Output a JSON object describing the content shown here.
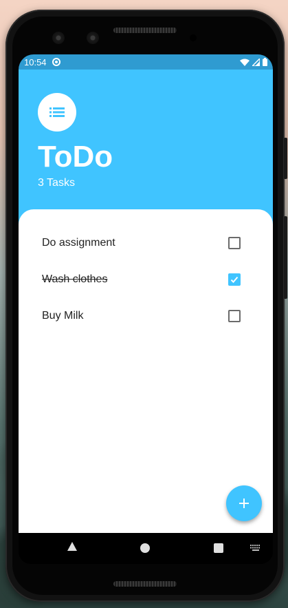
{
  "status_bar": {
    "time": "10:54"
  },
  "header": {
    "title": "ToDo",
    "subtitle": "3 Tasks"
  },
  "tasks": [
    {
      "label": "Do assignment",
      "done": false
    },
    {
      "label": "Wash clothes",
      "done": true
    },
    {
      "label": "Buy Milk",
      "done": false
    }
  ],
  "colors": {
    "accent": "#40c4ff",
    "status_bar": "#2f9bd1",
    "text": "#222222"
  },
  "icons": {
    "header_avatar": "list-icon",
    "fab": "plus-icon"
  }
}
